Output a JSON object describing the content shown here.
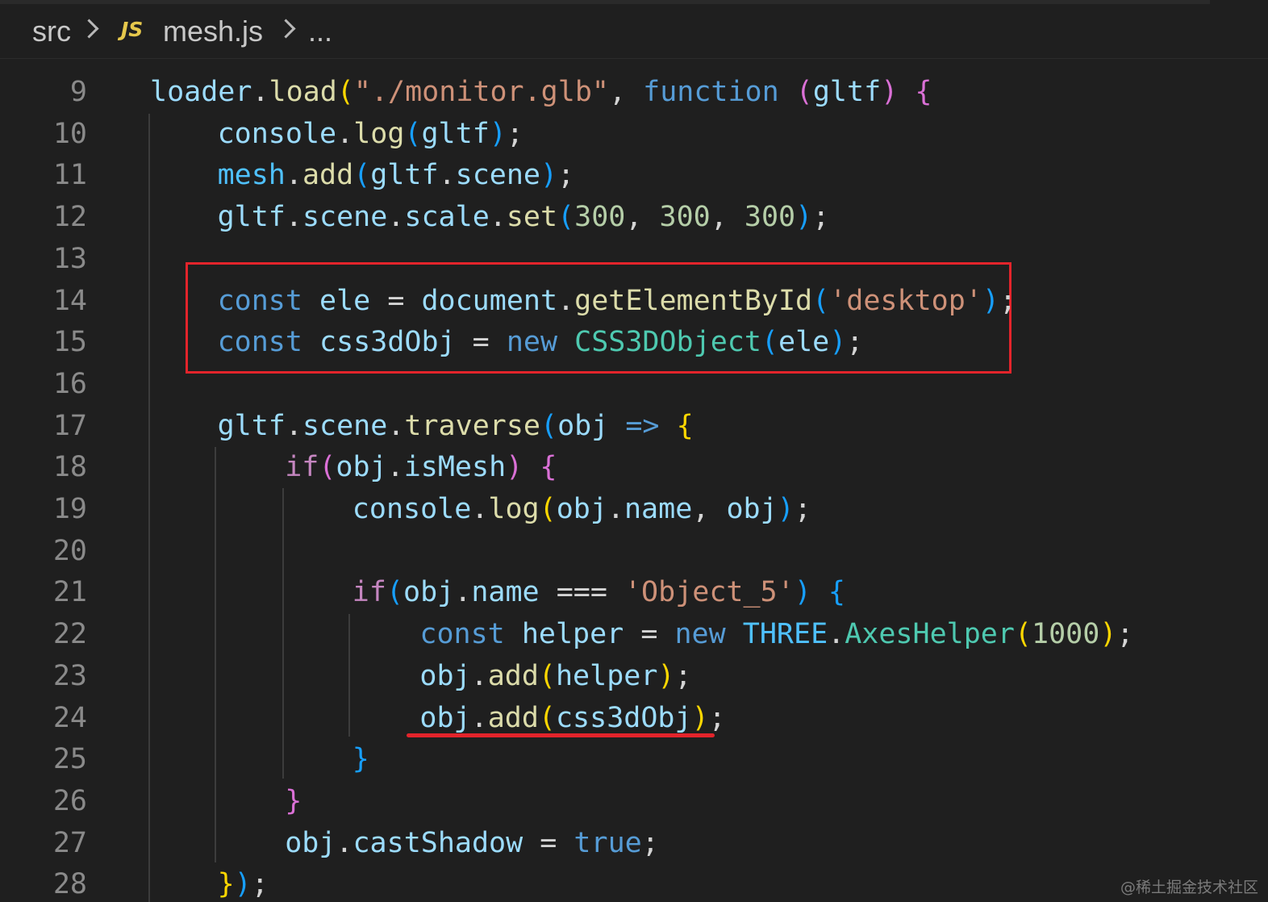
{
  "breadcrumb": {
    "folder": "src",
    "file_icon": "JS",
    "file": "mesh.js",
    "more": "..."
  },
  "editor": {
    "lines": [
      {
        "num": "9",
        "indent": 0,
        "tokens": [
          [
            "loader",
            "var"
          ],
          [
            ".",
            "punc"
          ],
          [
            "load",
            "fn"
          ],
          [
            "(",
            "b1"
          ],
          [
            "\"./monitor.glb\"",
            "str"
          ],
          [
            ", ",
            "punc"
          ],
          [
            "function",
            "kw"
          ],
          [
            " ",
            "punc"
          ],
          [
            "(",
            "b2"
          ],
          [
            "gltf",
            "var"
          ],
          [
            ")",
            "b2"
          ],
          [
            " ",
            "punc"
          ],
          [
            "{",
            "b2"
          ]
        ]
      },
      {
        "num": "10",
        "indent": 1,
        "tokens": [
          [
            "console",
            "var"
          ],
          [
            ".",
            "punc"
          ],
          [
            "log",
            "fn"
          ],
          [
            "(",
            "b3"
          ],
          [
            "gltf",
            "var"
          ],
          [
            ")",
            "b3"
          ],
          [
            ";",
            "punc"
          ]
        ]
      },
      {
        "num": "11",
        "indent": 1,
        "tokens": [
          [
            "mesh",
            "const"
          ],
          [
            ".",
            "punc"
          ],
          [
            "add",
            "fn"
          ],
          [
            "(",
            "b3"
          ],
          [
            "gltf",
            "var"
          ],
          [
            ".",
            "punc"
          ],
          [
            "scene",
            "var"
          ],
          [
            ")",
            "b3"
          ],
          [
            ";",
            "punc"
          ]
        ]
      },
      {
        "num": "12",
        "indent": 1,
        "tokens": [
          [
            "gltf",
            "var"
          ],
          [
            ".",
            "punc"
          ],
          [
            "scene",
            "var"
          ],
          [
            ".",
            "punc"
          ],
          [
            "scale",
            "var"
          ],
          [
            ".",
            "punc"
          ],
          [
            "set",
            "fn"
          ],
          [
            "(",
            "b3"
          ],
          [
            "300",
            "num"
          ],
          [
            ", ",
            "punc"
          ],
          [
            "300",
            "num"
          ],
          [
            ", ",
            "punc"
          ],
          [
            "300",
            "num"
          ],
          [
            ")",
            "b3"
          ],
          [
            ";",
            "punc"
          ]
        ]
      },
      {
        "num": "13",
        "indent": 1,
        "tokens": []
      },
      {
        "num": "14",
        "indent": 1,
        "tokens": [
          [
            "const",
            "kw"
          ],
          [
            " ",
            "punc"
          ],
          [
            "ele",
            "var"
          ],
          [
            " = ",
            "punc"
          ],
          [
            "document",
            "var"
          ],
          [
            ".",
            "punc"
          ],
          [
            "getElementById",
            "fn"
          ],
          [
            "(",
            "b3"
          ],
          [
            "'desktop'",
            "str"
          ],
          [
            ")",
            "b3"
          ],
          [
            ";",
            "punc"
          ]
        ]
      },
      {
        "num": "15",
        "indent": 1,
        "tokens": [
          [
            "const",
            "kw"
          ],
          [
            " ",
            "punc"
          ],
          [
            "css3dObj",
            "var"
          ],
          [
            " = ",
            "punc"
          ],
          [
            "new",
            "kw"
          ],
          [
            " ",
            "punc"
          ],
          [
            "CSS3DObject",
            "cls"
          ],
          [
            "(",
            "b3"
          ],
          [
            "ele",
            "var"
          ],
          [
            ")",
            "b3"
          ],
          [
            ";",
            "punc"
          ]
        ]
      },
      {
        "num": "16",
        "indent": 1,
        "tokens": []
      },
      {
        "num": "17",
        "indent": 1,
        "tokens": [
          [
            "gltf",
            "var"
          ],
          [
            ".",
            "punc"
          ],
          [
            "scene",
            "var"
          ],
          [
            ".",
            "punc"
          ],
          [
            "traverse",
            "fn"
          ],
          [
            "(",
            "b3"
          ],
          [
            "obj",
            "var"
          ],
          [
            " ",
            "punc"
          ],
          [
            "=>",
            "kw"
          ],
          [
            " ",
            "punc"
          ],
          [
            "{",
            "b1"
          ]
        ]
      },
      {
        "num": "18",
        "indent": 2,
        "tokens": [
          [
            "if",
            "ctl"
          ],
          [
            "(",
            "b2"
          ],
          [
            "obj",
            "var"
          ],
          [
            ".",
            "punc"
          ],
          [
            "isMesh",
            "var"
          ],
          [
            ")",
            "b2"
          ],
          [
            " ",
            "punc"
          ],
          [
            "{",
            "b2"
          ]
        ]
      },
      {
        "num": "19",
        "indent": 3,
        "tokens": [
          [
            "console",
            "var"
          ],
          [
            ".",
            "punc"
          ],
          [
            "log",
            "fn"
          ],
          [
            "(",
            "b1"
          ],
          [
            "obj",
            "var"
          ],
          [
            ".",
            "punc"
          ],
          [
            "name",
            "var"
          ],
          [
            ", ",
            "punc"
          ],
          [
            "obj",
            "var"
          ],
          [
            ")",
            "b3"
          ],
          [
            ";",
            "punc"
          ]
        ]
      },
      {
        "num": "20",
        "indent": 3,
        "tokens": []
      },
      {
        "num": "21",
        "indent": 3,
        "tokens": [
          [
            "if",
            "ctl"
          ],
          [
            "(",
            "b3"
          ],
          [
            "obj",
            "var"
          ],
          [
            ".",
            "punc"
          ],
          [
            "name",
            "var"
          ],
          [
            " === ",
            "punc"
          ],
          [
            "'Object_5'",
            "str"
          ],
          [
            ")",
            "b3"
          ],
          [
            " ",
            "punc"
          ],
          [
            "{",
            "b3"
          ]
        ]
      },
      {
        "num": "22",
        "indent": 4,
        "tokens": [
          [
            "const",
            "kw"
          ],
          [
            " ",
            "punc"
          ],
          [
            "helper",
            "var"
          ],
          [
            " = ",
            "punc"
          ],
          [
            "new",
            "kw"
          ],
          [
            " ",
            "punc"
          ],
          [
            "THREE",
            "const"
          ],
          [
            ".",
            "punc"
          ],
          [
            "AxesHelper",
            "cls"
          ],
          [
            "(",
            "b1"
          ],
          [
            "1000",
            "num"
          ],
          [
            ")",
            "b1"
          ],
          [
            ";",
            "punc"
          ]
        ]
      },
      {
        "num": "23",
        "indent": 4,
        "tokens": [
          [
            "obj",
            "var"
          ],
          [
            ".",
            "punc"
          ],
          [
            "add",
            "fn"
          ],
          [
            "(",
            "b1"
          ],
          [
            "helper",
            "var"
          ],
          [
            ")",
            "b1"
          ],
          [
            ";",
            "punc"
          ]
        ]
      },
      {
        "num": "24",
        "indent": 4,
        "tokens": [
          [
            "obj",
            "var"
          ],
          [
            ".",
            "punc"
          ],
          [
            "add",
            "fn"
          ],
          [
            "(",
            "b1"
          ],
          [
            "css3dObj",
            "var"
          ],
          [
            ")",
            "b1"
          ],
          [
            ";",
            "punc"
          ]
        ]
      },
      {
        "num": "25",
        "indent": 3,
        "tokens": [
          [
            "}",
            "b3"
          ]
        ]
      },
      {
        "num": "26",
        "indent": 2,
        "tokens": [
          [
            "}",
            "b2"
          ]
        ]
      },
      {
        "num": "27",
        "indent": 2,
        "tokens": [
          [
            "obj",
            "var"
          ],
          [
            ".",
            "punc"
          ],
          [
            "castShadow",
            "var"
          ],
          [
            " = ",
            "punc"
          ],
          [
            "true",
            "kw"
          ],
          [
            ";",
            "punc"
          ]
        ]
      },
      {
        "num": "28",
        "indent": 1,
        "tokens": [
          [
            "}",
            "b1"
          ],
          [
            ")",
            "b3"
          ],
          [
            ";",
            "punc"
          ]
        ]
      }
    ]
  },
  "highlights": {
    "box_lines": [
      "14",
      "15"
    ],
    "underline_line": "24",
    "color": "#e3242b"
  },
  "watermark": "@稀土掘金技术社区"
}
